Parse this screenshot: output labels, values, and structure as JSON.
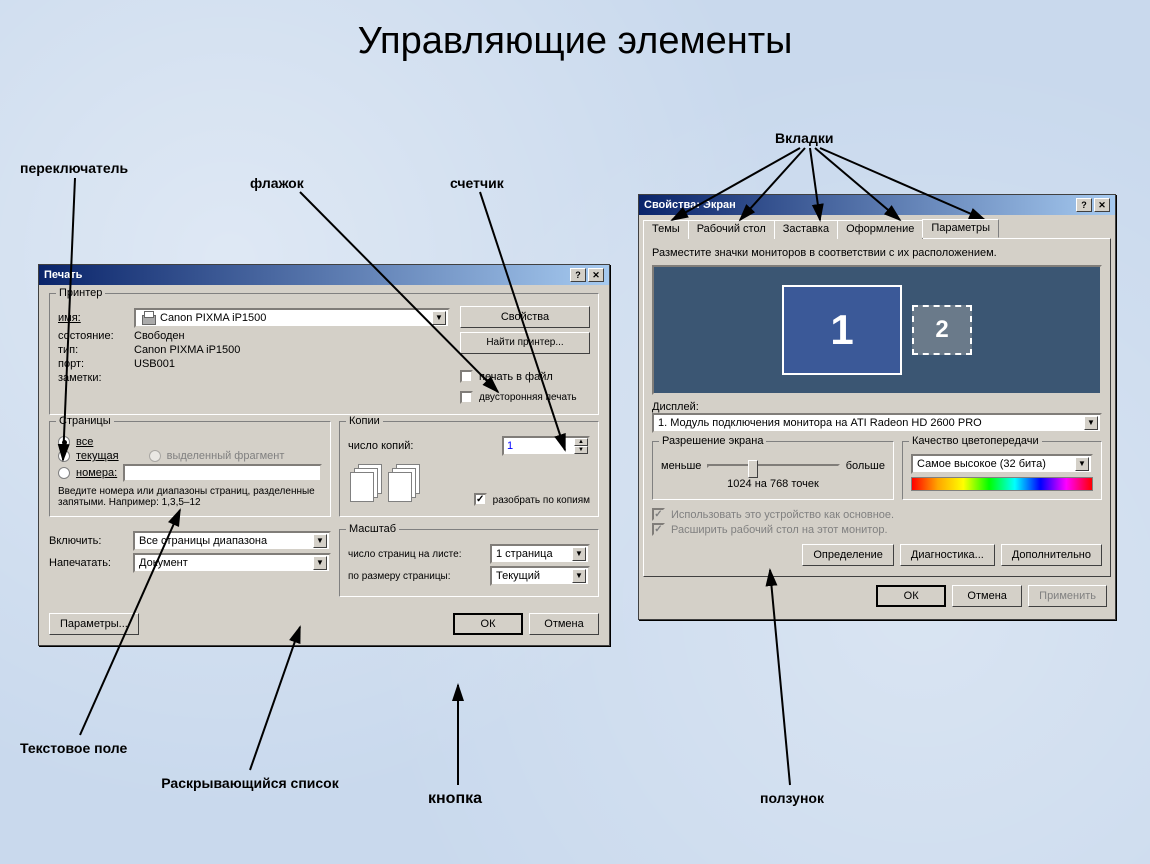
{
  "slide": {
    "title": "Управляющие элементы"
  },
  "labels": {
    "radio": "переключатель",
    "checkbox": "флажок",
    "spinner": "счетчик",
    "tabs": "Вкладки",
    "textfield": "Текстовое поле",
    "dropdown": "Раскрывающийся список",
    "button": "кнопка",
    "slider": "ползунок"
  },
  "printDialog": {
    "title": "Печать",
    "printerGroup": "Принтер",
    "name_lbl": "имя:",
    "name_value": "Canon PIXMA iP1500",
    "state_lbl": "состояние:",
    "state_value": "Свободен",
    "type_lbl": "тип:",
    "type_value": "Canon PIXMA iP1500",
    "port_lbl": "порт:",
    "port_value": "USB001",
    "notes_lbl": "заметки:",
    "properties_btn": "Свойства",
    "find_btn": "Найти принтер...",
    "print_to_file": "печать в файл",
    "duplex": "двусторонняя печать",
    "pagesGroup": "Страницы",
    "pages_all": "все",
    "pages_current": "текущая",
    "pages_selection": "выделенный фрагмент",
    "pages_numbers": "номера:",
    "pages_hint": "Введите номера или диапазоны страниц, разделенные запятыми. Например: 1,3,5–12",
    "copiesGroup": "Копии",
    "copies_lbl": "число копий:",
    "copies_value": "1",
    "collate": "разобрать по копиям",
    "include_lbl": "Включить:",
    "include_value": "Все страницы диапазона",
    "print_what_lbl": "Напечатать:",
    "print_what_value": "Документ",
    "scaleGroup": "Масштаб",
    "pages_per_sheet_lbl": "число страниц на листе:",
    "pages_per_sheet_value": "1 страница",
    "fit_to_lbl": "по размеру страницы:",
    "fit_to_value": "Текущий",
    "options_btn": "Параметры...",
    "ok_btn": "ОК",
    "cancel_btn": "Отмена"
  },
  "displayDialog": {
    "title": "Свойства: Экран",
    "tabs": [
      "Темы",
      "Рабочий стол",
      "Заставка",
      "Оформление",
      "Параметры"
    ],
    "active_tab": 4,
    "hint": "Разместите значки мониторов в соответствии с их расположением.",
    "monitor1": "1",
    "monitor2": "2",
    "display_lbl": "Дисплей:",
    "display_value": "1. Модуль подключения монитора на ATI Radeon HD 2600 PRO",
    "resGroup": "Разрешение экрана",
    "res_less": "меньше",
    "res_more": "больше",
    "res_value": "1024 на 768 точек",
    "qualityGroup": "Качество цветопередачи",
    "quality_value": "Самое высокое (32 бита)",
    "use_primary": "Использовать это устройство как основное.",
    "extend": "Расширить рабочий стол на этот монитор.",
    "identify_btn": "Определение",
    "diag_btn": "Диагностика...",
    "advanced_btn": "Дополнительно",
    "ok_btn": "ОК",
    "cancel_btn": "Отмена",
    "apply_btn": "Применить"
  }
}
